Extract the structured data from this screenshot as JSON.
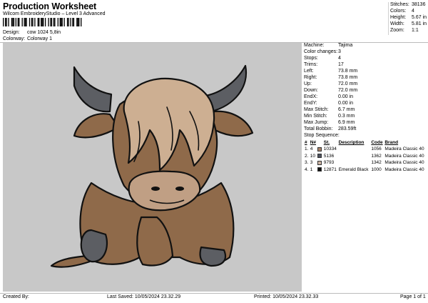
{
  "header": {
    "title": "Production Worksheet",
    "subtitle": "Wilcom EmbroideryStudio – Level 3 Advanced",
    "barcode_suffix": ","
  },
  "design_meta": {
    "design_label": "Design:",
    "design_value": "cow 1024 5,8in",
    "colorway_label": "Colorway:",
    "colorway_value": "Colorway 1"
  },
  "stats": {
    "stitches_label": "Stitches:",
    "stitches_value": "38136",
    "colors_label": "Colors:",
    "colors_value": "4",
    "height_label": "Height:",
    "height_value": "5.67 in",
    "width_label": "Width:",
    "width_value": "5.81 in",
    "zoom_label": "Zoom:",
    "zoom_value": "1:1"
  },
  "machine_info": {
    "machine_label": "Machine:",
    "machine_value": "Tajima",
    "color_changes_label": "Color changes:",
    "color_changes_value": "3",
    "stops_label": "Stops:",
    "stops_value": "4",
    "trims_label": "Trims:",
    "trims_value": "17",
    "left_label": "Left:",
    "left_value": "73.8 mm",
    "right_label": "Right:",
    "right_value": "73.8 mm",
    "up_label": "Up:",
    "up_value": "72.0 mm",
    "down_label": "Down:",
    "down_value": "72.0 mm",
    "endx_label": "EndX:",
    "endx_value": "0.00 in",
    "endy_label": "EndY:",
    "endy_value": "0.00 in",
    "max_stitch_label": "Max Stitch:",
    "max_stitch_value": "6.7 mm",
    "min_stitch_label": "Min Stitch:",
    "min_stitch_value": "0.3 mm",
    "max_jump_label": "Max Jump:",
    "max_jump_value": "6.9 mm",
    "total_bobbin_label": "Total Bobbin:",
    "total_bobbin_value": "283.59ft"
  },
  "stop_sequence": {
    "title": "Stop Sequence:",
    "headers": [
      "#",
      "N#",
      "",
      "St.",
      "Description",
      "Code",
      "Brand"
    ],
    "rows": [
      {
        "idx": "1.",
        "n": "4",
        "color": "#a8836a",
        "st": "10334",
        "desc": "",
        "code": "1056",
        "brand": "Madeira Classic 40"
      },
      {
        "idx": "2.",
        "n": "10",
        "color": "#4e5360",
        "st": "5136",
        "desc": "",
        "code": "1362",
        "brand": "Madeira Classic 40"
      },
      {
        "idx": "3.",
        "n": "3",
        "color": "#cdb4a4",
        "st": "9793",
        "desc": "",
        "code": "1342",
        "brand": "Madeira Classic 40"
      },
      {
        "idx": "4.",
        "n": "1",
        "color": "#111111",
        "st": "12871",
        "desc": "Emerald Black",
        "code": "1000",
        "brand": "Madeira Classic 40"
      }
    ]
  },
  "footer": {
    "created_by": "Created By:",
    "last_saved": "Last Saved: 10/05/2024 23.32.29",
    "printed": "Printed: 10/05/2024 23.32.33",
    "page": "Page 1 of 1"
  },
  "colors": {
    "canvas_bg": "#c8c8c8",
    "fur_brown": "#8f6a4a",
    "fur_light": "#cdaf92",
    "horn_gray": "#5c5e63",
    "muzzle": "#c09f84",
    "outline": "#111111"
  }
}
